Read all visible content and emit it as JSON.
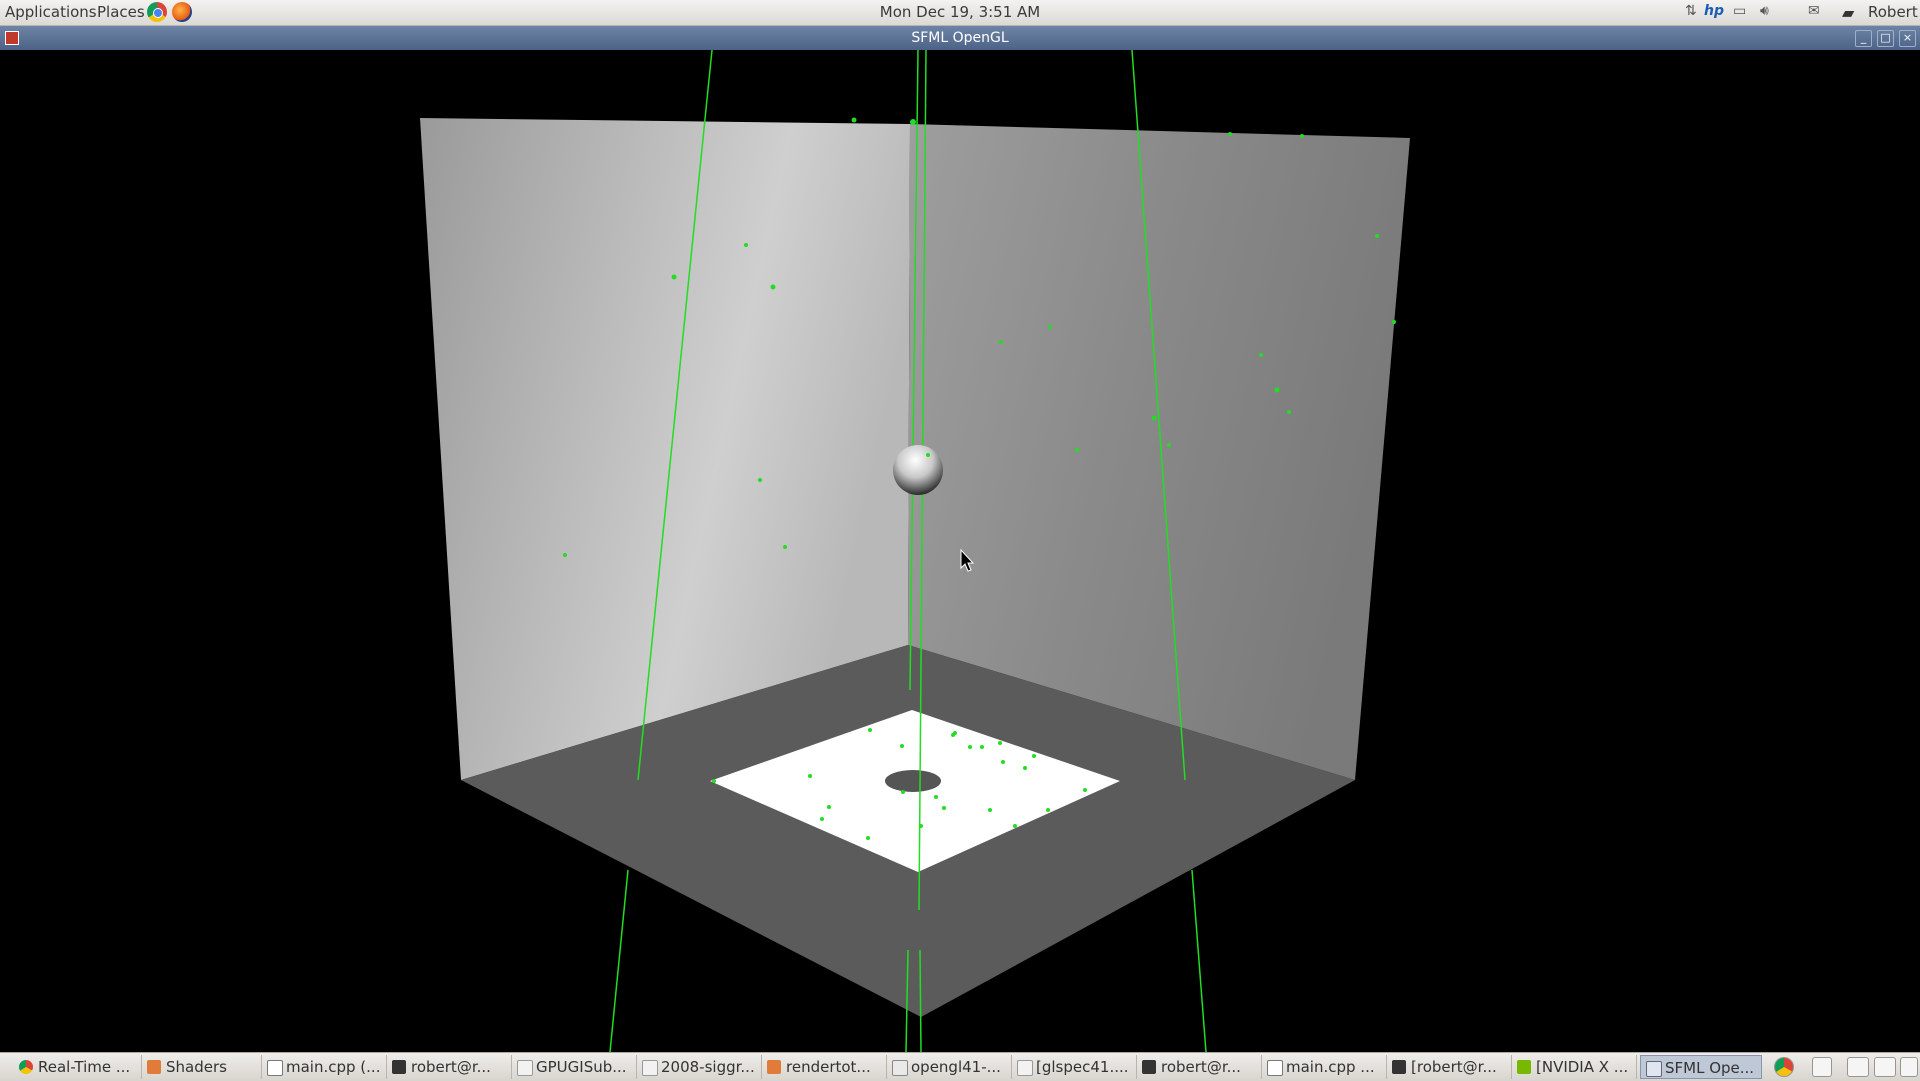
{
  "panel": {
    "applications_label": "Applications",
    "places_label": "Places",
    "clock": "Mon Dec 19,  3:51 AM",
    "user_name": "Robert"
  },
  "window": {
    "title": "SFML OpenGL"
  },
  "taskbar": {
    "items": [
      {
        "label": "Real-Time ...",
        "icon": "chrome-icon"
      },
      {
        "label": "Shaders",
        "icon": "folder-icon"
      },
      {
        "label": "main.cpp (...",
        "icon": "text-editor-icon"
      },
      {
        "label": "robert@r...",
        "icon": "terminal-icon"
      },
      {
        "label": "GPUGISub...",
        "icon": "document-icon"
      },
      {
        "label": "2008-siggr...",
        "icon": "document-icon"
      },
      {
        "label": "rendertot...",
        "icon": "folder-icon"
      },
      {
        "label": "opengl41-...",
        "icon": "pdf-icon"
      },
      {
        "label": "[glspec41....",
        "icon": "document-icon"
      },
      {
        "label": "robert@r...",
        "icon": "terminal-icon"
      },
      {
        "label": "main.cpp ...",
        "icon": "text-editor-icon"
      },
      {
        "label": "[robert@r...",
        "icon": "terminal-icon"
      },
      {
        "label": "[NVIDIA X ...",
        "icon": "nvidia-icon"
      },
      {
        "label": "SFML Ope...",
        "icon": "window-icon"
      }
    ]
  },
  "colors": {
    "accent_green": "#22dd22",
    "panel_bg": "#e6e4e0",
    "title_bar": "#5a7096"
  }
}
